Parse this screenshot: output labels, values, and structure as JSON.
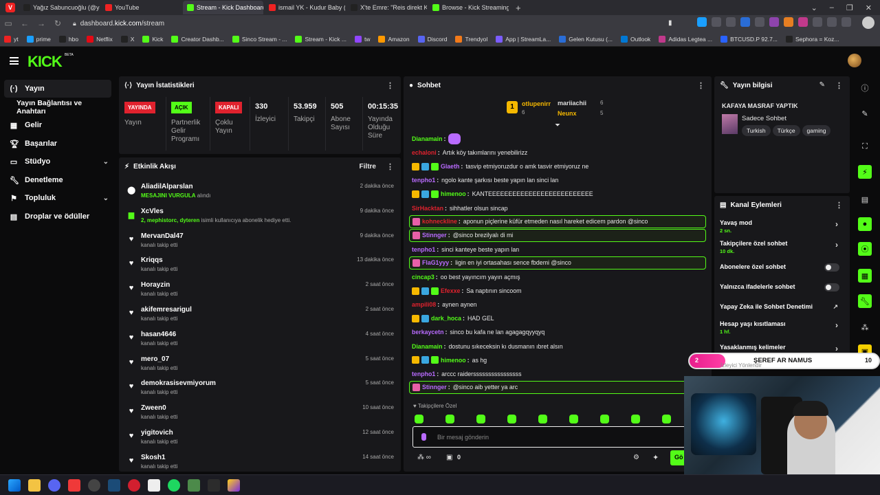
{
  "browser": {
    "tabs": [
      {
        "label": "Yağız Sabuncuoğlu (@yagı",
        "color": "#222"
      },
      {
        "label": "YouTube",
        "color": "#e22"
      },
      {
        "label": "Stream - Kick Dashboard",
        "color": "#53fc18"
      },
      {
        "label": "ismail YK - Kudur Baby ( U",
        "color": "#e22"
      },
      {
        "label": "X'te Emre: \"Reis direkt Kant",
        "color": "#222"
      },
      {
        "label": "Browse - Kick Streaming",
        "color": "#53fc18"
      }
    ],
    "active_tab_index": 2,
    "url_prefix": "dashboard.",
    "url_domain": "kick.com",
    "url_path": "/stream",
    "bookmarks": [
      "yt",
      "prime",
      "hbo",
      "Netflix",
      "X",
      "Kick",
      "Creator Dashb...",
      "Sinco Stream - ...",
      "Stream - Kick ...",
      "tw",
      "Amazon",
      "Discord",
      "Trendyol",
      "App | StreamLa...",
      "Gelen Kutusu (...",
      "Outlook",
      "Adidas Legtea ...",
      "BTCUSD.P 92.7...",
      "Sephora = Koz..."
    ]
  },
  "brand": {
    "logo": "KICK",
    "beta": "BETA",
    "accent": "#53fc18"
  },
  "sidebar": {
    "items": [
      {
        "label": "Yayın",
        "icon": "broadcast-icon",
        "active": true
      },
      {
        "label": "Yayın Bağlantısı ve Anahtarı",
        "icon": "",
        "active": false
      },
      {
        "label": "Gelir",
        "icon": "chart-icon",
        "active": false
      },
      {
        "label": "Başarılar",
        "icon": "trophy-icon",
        "active": false
      },
      {
        "label": "Stüdyo",
        "icon": "studio-icon",
        "active": false,
        "expand": true
      },
      {
        "label": "Denetleme",
        "icon": "wrench-icon",
        "active": false
      },
      {
        "label": "Topluluk",
        "icon": "community-icon",
        "active": false,
        "expand": true
      },
      {
        "label": "Droplar ve ödüller",
        "icon": "gift-icon",
        "active": false
      }
    ]
  },
  "stats": {
    "title": "Yayın İstatistikleri",
    "items": [
      {
        "badge": "YAYINDA",
        "badge_color": "#e0222e",
        "label": "Yayın"
      },
      {
        "badge": "AÇIK",
        "badge_color": "#53fc18",
        "label": "Partnerlik Gelir Programı"
      },
      {
        "badge": "KAPALI",
        "badge_color": "#e0222e",
        "label": "Çoklu Yayın"
      },
      {
        "value": "330",
        "label": "İzleyici"
      },
      {
        "value": "53.959",
        "label": "Takipçi"
      },
      {
        "value": "505",
        "label": "Abone Sayısı"
      },
      {
        "value": "00:15:35",
        "label": "Yayında Olduğu Süre"
      }
    ]
  },
  "activity": {
    "title": "Etkinlik Akışı",
    "filter": "Filtre",
    "items": [
      {
        "name": "AliadilAlparslan",
        "sub_hl": "MESAJINI VURGULA",
        "sub": " alındı",
        "time": "2 dakika önce",
        "icon": "pin-icon"
      },
      {
        "name": "XcVles",
        "sub_hl": "2, mephistorc, dyteren",
        "sub": " isimli kullanıcıya abonelik hediye etti.",
        "time": "9 dakika önce",
        "icon": "gift-icon"
      },
      {
        "name": "MervanDal47",
        "sub": "kanalı takip etti",
        "time": "9 dakika önce",
        "icon": "heart-icon"
      },
      {
        "name": "Kriqqs",
        "sub": "kanalı takip etti",
        "time": "13 dakika önce",
        "icon": "heart-icon"
      },
      {
        "name": "Horayzin",
        "sub": "kanalı takip etti",
        "time": "2 saat önce",
        "icon": "heart-icon"
      },
      {
        "name": "akifemresarigul",
        "sub": "kanalı takip etti",
        "time": "2 saat önce",
        "icon": "heart-icon"
      },
      {
        "name": "hasan4646",
        "sub": "kanalı takip etti",
        "time": "4 saat önce",
        "icon": "heart-icon"
      },
      {
        "name": "mero_07",
        "sub": "kanalı takip etti",
        "time": "5 saat önce",
        "icon": "heart-icon"
      },
      {
        "name": "demokrasisevmiyorum",
        "sub": "kanalı takip etti",
        "time": "5 saat önce",
        "icon": "heart-icon"
      },
      {
        "name": "Zween0",
        "sub": "kanalı takip etti",
        "time": "10 saat önce",
        "icon": "heart-icon"
      },
      {
        "name": "yigitovich",
        "sub": "kanalı takip etti",
        "time": "12 saat önce",
        "icon": "heart-icon"
      },
      {
        "name": "Skosh1",
        "sub": "kanalı takip etti",
        "time": "14 saat önce",
        "icon": "heart-icon"
      }
    ]
  },
  "chat": {
    "title": "Sohbet",
    "top_gifters": [
      {
        "name": "otlupenirr",
        "count": "6",
        "rank": "1"
      },
      {
        "name": "mariiachii",
        "count": "6"
      },
      {
        "name": "Neunx",
        "count": "5"
      }
    ],
    "messages": [
      {
        "user": "Dianamain",
        "color": "#53fc18",
        "text": "",
        "badges": 0,
        "emote": true
      },
      {
        "user": "echaloni",
        "color": "#e0222e",
        "text": "Artık köy takımlarını yenebilirizz",
        "badges": 0
      },
      {
        "user": "Glaeth",
        "color": "#b96bff",
        "text": "tasvip etmiyoruzdur o amk tasvir etmiyoruz ne",
        "badges": 3
      },
      {
        "user": "tenpho1",
        "color": "#b96bff",
        "text": "ngolo kante şarkısı beste yapın lan sinci lan",
        "badges": 0
      },
      {
        "user": "himenoo",
        "color": "#53fc18",
        "text": "KANTEEEEEEEEEEEEEEEEEEEEEEEEEE",
        "badges": 3
      },
      {
        "user": "SirHacktan",
        "color": "#e0222e",
        "text": "sihhatler olsun sincap",
        "badges": 0
      },
      {
        "user": "kohneckline",
        "color": "#e0222e",
        "text": "aponun piçlerine küfür etmeden nasıl hareket edicem pardon @sinco",
        "badges": 1,
        "hl": true
      },
      {
        "user": "Stinnger",
        "color": "#b96bff",
        "text": "@sinco brezilyalı di mi",
        "badges": 1,
        "hl": true
      },
      {
        "user": "tenpho1",
        "color": "#b96bff",
        "text": "sinci kanteye beste yapın lan",
        "badges": 0
      },
      {
        "user": "FlaG1yyy",
        "color": "#b96bff",
        "text": "ligin en iyi ortasahası sence fbdemi @sinco",
        "badges": 1,
        "hl": true
      },
      {
        "user": "cincap3",
        "color": "#53fc18",
        "text": "oo best yayıncım yayın açmış",
        "badges": 0
      },
      {
        "user": "Efexxe",
        "color": "#e0222e",
        "text": "Sa naptının sincoom",
        "badges": 3
      },
      {
        "user": "ampili08",
        "color": "#e0222e",
        "text": "aynen aynen",
        "badges": 0
      },
      {
        "user": "dark_hoca",
        "color": "#53fc18",
        "text": "HAD GEL",
        "badges": 2
      },
      {
        "user": "berkaycetn",
        "color": "#b96bff",
        "text": "sinco bu kafa ne lan agagagqyyqyq",
        "badges": 0
      },
      {
        "user": "Dianamain",
        "color": "#53fc18",
        "text": "dostunu sıkeceksin kı dusmanın ıbret alsın",
        "badges": 0
      },
      {
        "user": "himenoo",
        "color": "#53fc18",
        "text": "as hg",
        "badges": 3
      },
      {
        "user": "tenpho1",
        "color": "#b96bff",
        "text": "arccc raiderssssssssssssssss",
        "badges": 0
      },
      {
        "user": "Stinnger",
        "color": "#b96bff",
        "text": "@sinco aib yetter ya arc",
        "badges": 1,
        "hl": true
      }
    ],
    "followers_only": "Takipçilere Özel",
    "input_placeholder": "Bir mesaj gönderin",
    "points": "0",
    "send_label": "Gö"
  },
  "stream_info": {
    "title": "Yayın bilgisi",
    "stream_title": "KAFAYA MASRAF YAPTIK",
    "category": "Sadece Sohbet",
    "tags": [
      "Turkish",
      "Türkçe",
      "gaming"
    ]
  },
  "channel_actions": {
    "title": "Kanal Eylemleri",
    "items": [
      {
        "label": "Yavaş mod",
        "sub": "2 sn.",
        "type": "arrow"
      },
      {
        "label": "Takipçilere özel sohbet",
        "sub": "10 dk.",
        "type": "arrow"
      },
      {
        "label": "Abonelere özel sohbet",
        "sub": "",
        "type": "toggle"
      },
      {
        "label": "Yalnızca ifadelerle sohbet",
        "sub": "",
        "type": "toggle"
      },
      {
        "label": "Yapay Zeka ile Sohbet Denetimi",
        "sub": "",
        "type": "external"
      },
      {
        "label": "Hesap yaşı kısıtlaması",
        "sub": "1 hf.",
        "type": "arrow"
      },
      {
        "label": "Yasaklanmış kelimeler",
        "sub": "",
        "type": "arrow"
      }
    ]
  },
  "overlay": {
    "left_num": "2",
    "text": "ŞEREF AR NAMUS",
    "right_num": "10",
    "sub": "İzleyici Yönlendir"
  }
}
